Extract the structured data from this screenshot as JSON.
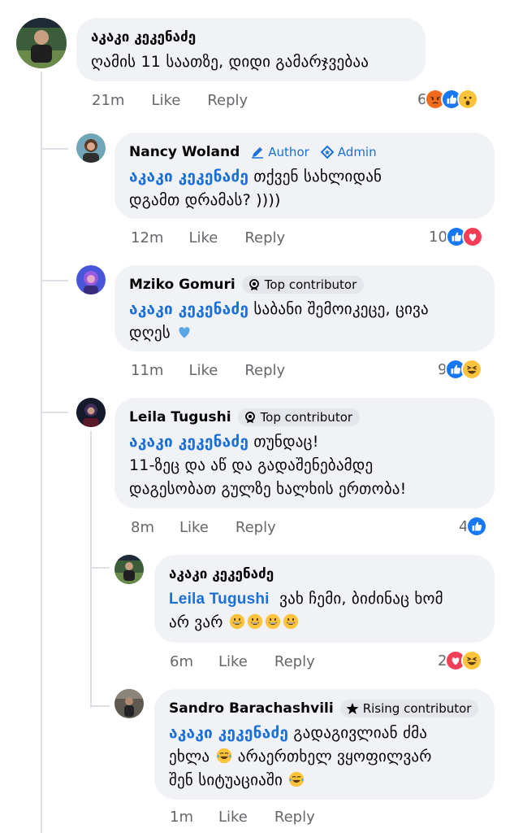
{
  "comments": [
    {
      "author": "აკაკი კეკენაძე",
      "text": "ღამის 11 საათზე, დიდი გამარჯვებაა",
      "time": "21m",
      "like": "Like",
      "reply": "Reply",
      "reaction_count": "6",
      "reactions": [
        "angry",
        "like",
        "wow"
      ]
    },
    {
      "author": "Nancy Woland",
      "badges": [
        "Author",
        "Admin"
      ],
      "mention": "აკაკი კეკენაძე",
      "text_line1": "თქვენ სახლიდან",
      "text_line2": "დგამთ დრამას? ))))",
      "time": "12m",
      "like": "Like",
      "reply": "Reply",
      "reaction_count": "10",
      "reactions": [
        "like",
        "love"
      ]
    },
    {
      "author": "Mziko Gomuri",
      "badges": [
        "Top contributor"
      ],
      "mention": "აკაკი კეკენაძე",
      "text_line1": "საბანი შემოიკეცე, ცივა",
      "text_line2": "დღეს",
      "time": "11m",
      "like": "Like",
      "reply": "Reply",
      "reaction_count": "9",
      "reactions": [
        "like",
        "haha"
      ]
    },
    {
      "author": "Leila Tugushi",
      "badges": [
        "Top contributor"
      ],
      "mention": "აკაკი კეკენაძე",
      "text_line1": "თუნდაც!",
      "text_line2": "11-ზეც და აწ და გადაშენებამდე",
      "text_line3": "დაგესობათ გულზე ხალხის ერთობა!",
      "time": "8m",
      "like": "Like",
      "reply": "Reply",
      "reaction_count": "4",
      "reactions": [
        "like"
      ]
    },
    {
      "author": "აკაკი კეკენაძე",
      "mention": "Leila Tugushi",
      "text_line1": "ვახ ჩემი, ბიძინაც ხომ",
      "text_line2": "არ ვარ",
      "time": "6m",
      "like": "Like",
      "reply": "Reply",
      "reaction_count": "2",
      "reactions": [
        "love",
        "haha"
      ]
    },
    {
      "author": "Sandro Barachashvili",
      "badges": [
        "Rising contributor"
      ],
      "mention": "აკაკი კეკენაძე",
      "text_line1": "გადაგივლიან ძმა",
      "text_line2a": "ეხლა",
      "text_line2b": "არაერთხელ ვყოფილვარ",
      "text_line3": "შენ სიტუაციაში",
      "time": "1m",
      "like": "Like",
      "reply": "Reply"
    }
  ],
  "colors": {
    "accent": "#1a6fd8",
    "bubble": "#f0f2f5",
    "meta": "#65676b",
    "line": "#dcdfe4"
  }
}
